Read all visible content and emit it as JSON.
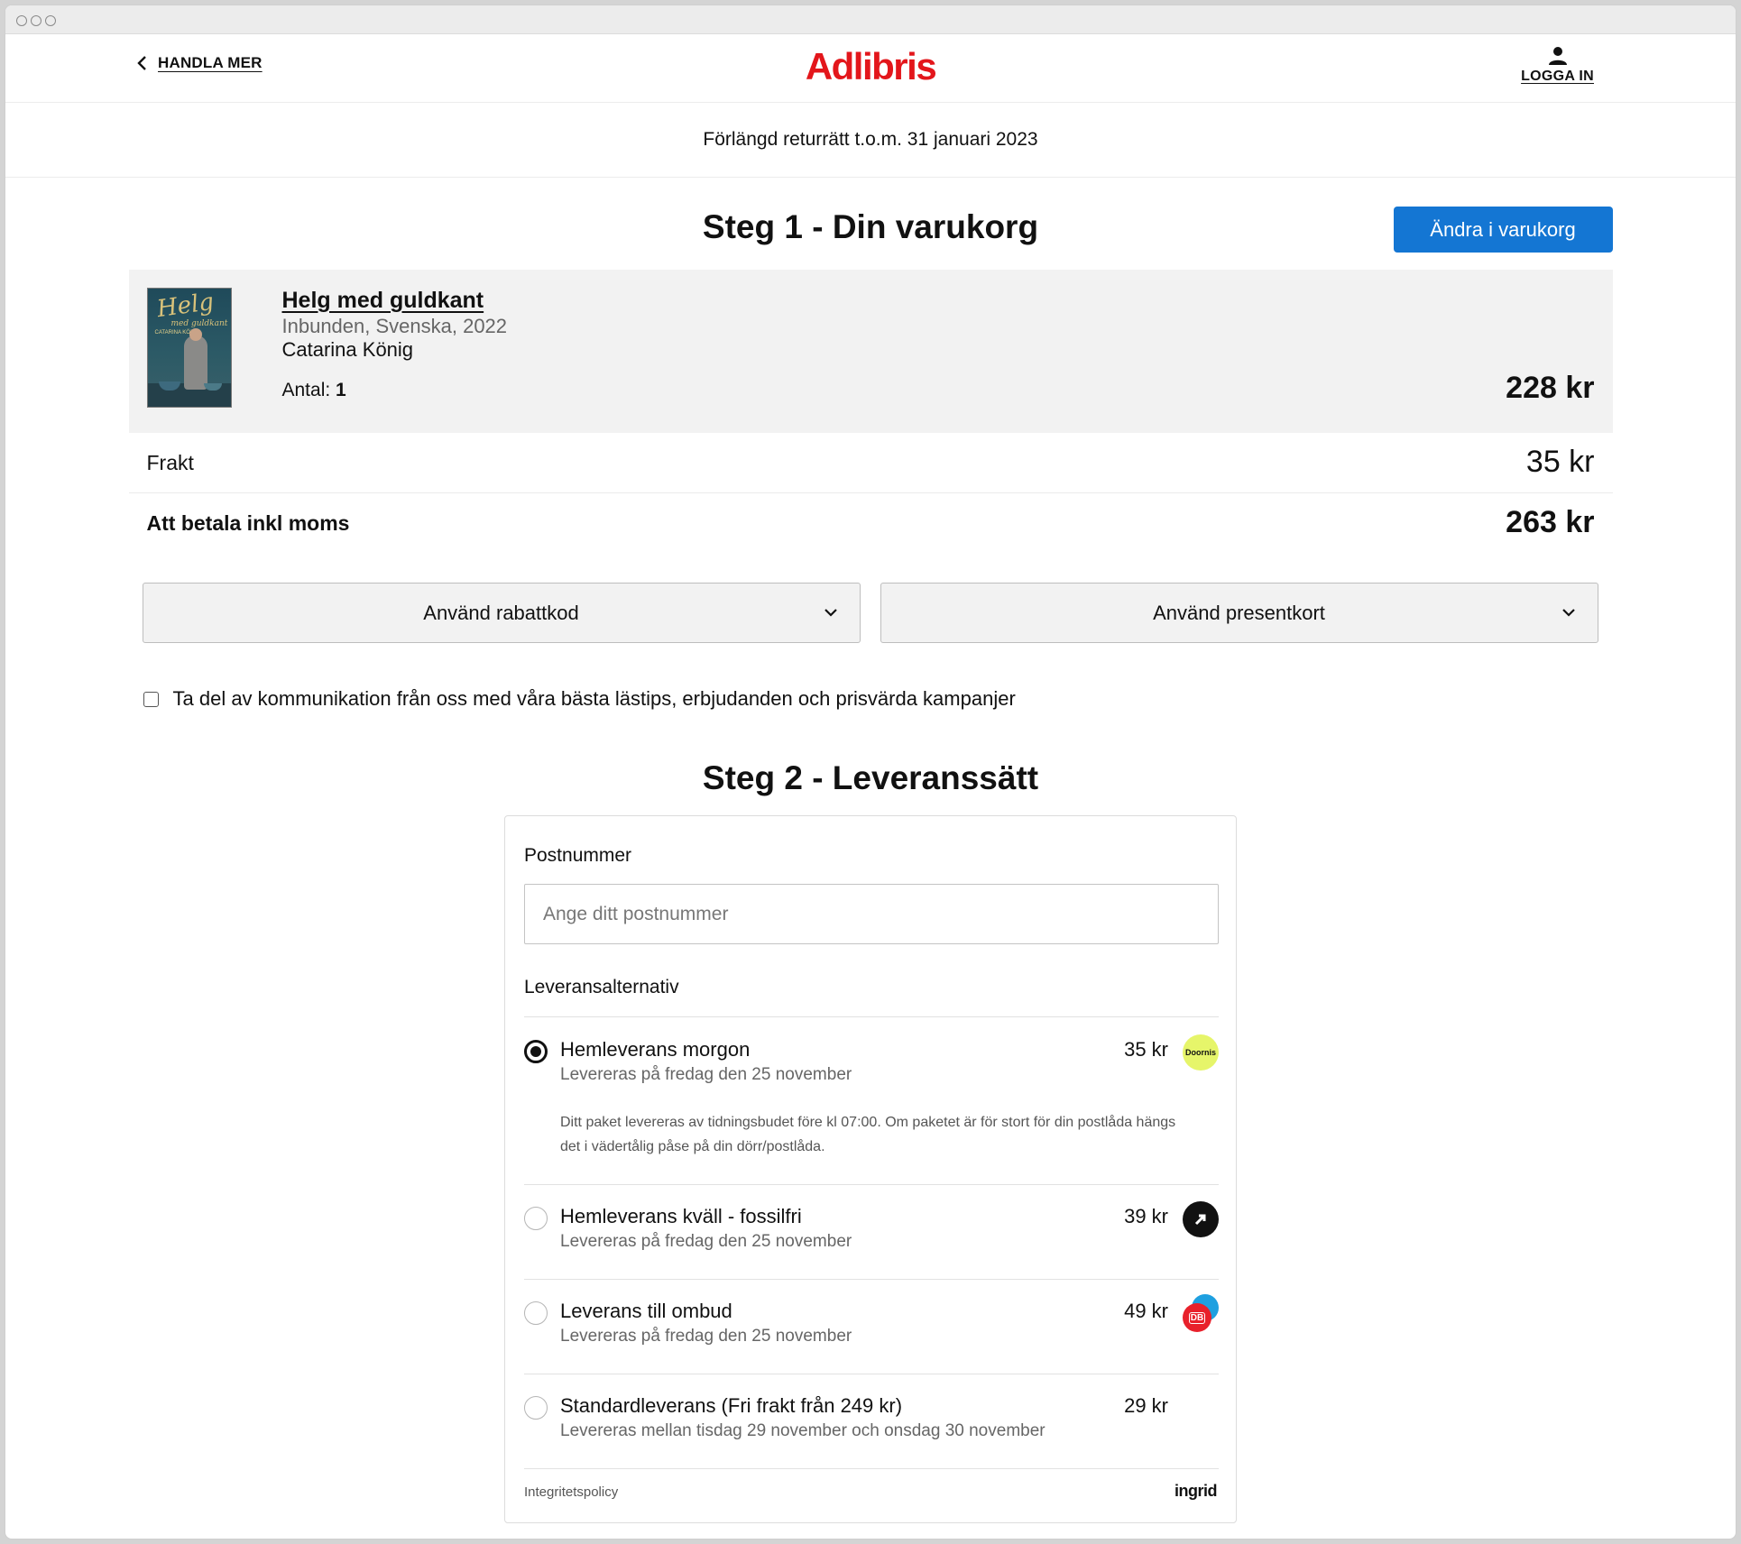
{
  "header": {
    "back_label": "HANDLA MER",
    "logo": "Adlibris",
    "login_label": "LOGGA IN"
  },
  "banner": {
    "text": "Förlängd returrätt t.o.m. 31 januari 2023"
  },
  "step1": {
    "title": "Steg 1 - Din varukorg",
    "edit_button": "Ändra i varukorg",
    "item": {
      "title": "Helg med guldkant",
      "format": "Inbunden, Svenska, 2022",
      "author": "Catarina König",
      "qty_label": "Antal:",
      "qty_value": "1",
      "price": "228 kr",
      "cover": {
        "title": "Helg",
        "subtitle": "med guldkant",
        "author": "CATARINA KÖNIG"
      }
    },
    "shipping_label": "Frakt",
    "shipping_value": "35 kr",
    "total_label": "Att betala inkl moms",
    "total_value": "263 kr",
    "discount_label": "Använd rabattkod",
    "giftcard_label": "Använd presentkort",
    "consent_label": "Ta del av kommunikation från oss med våra bästa lästips, erbjudanden och prisvärda kampanjer"
  },
  "step2": {
    "title": "Steg 2 - Leveranssätt",
    "postcode_label": "Postnummer",
    "postcode_placeholder": "Ange ditt postnummer",
    "postcode_value": "",
    "options_label": "Leveransalternativ",
    "options": [
      {
        "name": "Hemleverans morgon",
        "date": "Levereras på fredag den 25 november",
        "price": "35 kr",
        "selected": true,
        "carrier": "Doornis",
        "carrier_icon": "doornis-logo-icon",
        "description": "Ditt paket levereras av tidningsbudet före kl 07:00. Om paketet är för stort för din postlåda hängs det i vädertålig påse på din dörr/postlåda."
      },
      {
        "name": "Hemleverans kväll - fossilfri",
        "date": "Levereras på fredag den 25 november",
        "price": "39 kr",
        "selected": false,
        "carrier_icon": "budbee-logo-icon"
      },
      {
        "name": "Leverans till ombud",
        "date": "Levereras på fredag den 25 november",
        "price": "49 kr",
        "selected": false,
        "carrier": "DB",
        "carrier_icon": "db-schenker-logo-icon"
      },
      {
        "name": "Standardleverans (Fri frakt från 249 kr)",
        "date": "Levereras mellan tisdag 29 november och onsdag 30 november",
        "price": "29 kr",
        "selected": false
      }
    ],
    "privacy_link": "Integritetspolicy",
    "provider": "ingrid"
  },
  "colors": {
    "brand_red": "#e3161b",
    "primary_blue": "#1476d3",
    "doornis_yellow": "#e6f56a"
  }
}
